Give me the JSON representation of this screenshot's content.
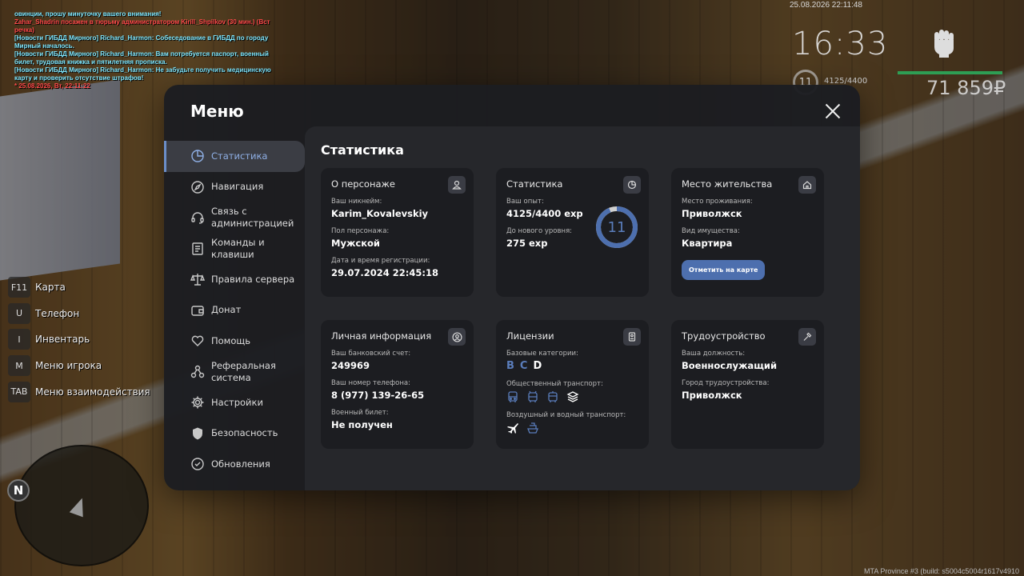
{
  "chat": [
    {
      "text": "овинции, прошу минуточку вашего внимания!",
      "color": "cyan"
    },
    {
      "text": "Zahar_Shadrin посажен в тюрьму администратором Kirill_Shpilkov (30 мин.) (Вст",
      "color": "red"
    },
    {
      "text": "речка)",
      "color": "red"
    },
    {
      "text": "[Новости ГИБДД Мирного] Richard_Harmon: Собеседование в ГИБДД по городу",
      "color": "cyan"
    },
    {
      "text": " Мирный началось.",
      "color": "cyan"
    },
    {
      "text": "[Новости ГИБДД Мирного] Richard_Harmon: Вам потребуется паспорт, военный",
      "color": "cyan"
    },
    {
      "text": " билет, трудовая книжка и пятилетняя прописка.",
      "color": "cyan"
    },
    {
      "text": "[Новости ГИБДД Мирного] Richard_Harmon: Не забудьте получить медицинскую",
      "color": "cyan"
    },
    {
      "text": " карту и проверить отсутствие штрафов!",
      "color": "cyan"
    },
    {
      "text": " * 25.08.2026, Вт, 22:11:22",
      "color": "red"
    }
  ],
  "hud": {
    "datetime": "25.08.2026 22:11:48",
    "time": "16:33",
    "level": "11",
    "exp": "4125/4400",
    "money": "71 859₽",
    "fist_icon": "fist-icon"
  },
  "keybinds": [
    {
      "key": "F11",
      "label": "Карта"
    },
    {
      "key": "U",
      "label": "Телефон"
    },
    {
      "key": "I",
      "label": "Инвентарь"
    },
    {
      "key": "M",
      "label": "Меню игрока"
    },
    {
      "key": "TAB",
      "label": "Меню взаимодействия"
    }
  ],
  "minimap": {
    "north": "N"
  },
  "build_info": "MTA Province #3 (build: s5004c5004r1617v4910",
  "menu": {
    "title": "Меню",
    "accent": "#6b8ec8",
    "nav": [
      {
        "label": "Статистика",
        "icon": "pie-chart-icon",
        "active": true
      },
      {
        "label": "Навигация",
        "icon": "compass-icon"
      },
      {
        "label": "Связь с администрацией",
        "icon": "headset-icon"
      },
      {
        "label": "Команды и клавиши",
        "icon": "document-icon"
      },
      {
        "label": "Правила сервера",
        "icon": "scales-icon"
      },
      {
        "label": "Донат",
        "icon": "wallet-icon"
      },
      {
        "label": "Помощь",
        "icon": "heart-hand-icon"
      },
      {
        "label": "Реферальная система",
        "icon": "network-icon"
      },
      {
        "label": "Настройки",
        "icon": "gear-icon"
      },
      {
        "label": "Безопасность",
        "icon": "shield-icon"
      },
      {
        "label": "Обновления",
        "icon": "refresh-icon"
      }
    ]
  },
  "content": {
    "title": "Статистика",
    "character": {
      "title": "О персонаже",
      "nick_label": "Ваш никнейм:",
      "nick": "Karim_Kovalevskiy",
      "sex_label": "Пол персонажа:",
      "sex": "Мужской",
      "reg_label": "Дата и время регистрации:",
      "reg": "29.07.2024 22:45:18"
    },
    "stats": {
      "title": "Статистика",
      "exp_label": "Ваш опыт:",
      "exp": "4125/4400 exp",
      "next_label": "До нового уровня:",
      "next": "275 exp",
      "level": "11",
      "level_progress": 0.9375
    },
    "residence": {
      "title": "Место жительства",
      "place_label": "Место проживания:",
      "place": "Приволжск",
      "property_label": "Вид имущества:",
      "property": "Квартира",
      "button": "Отметить на карте"
    },
    "personal": {
      "title": "Личная информация",
      "bank_label": "Ваш банковский счет:",
      "bank": "249969",
      "phone_label": "Ваш номер телефона:",
      "phone": "8 (977) 139-26-65",
      "military_label": "Военный билет:",
      "military": "Не получен"
    },
    "licenses": {
      "title": "Лицензии",
      "base_label": "Базовые категории:",
      "categories": [
        {
          "letter": "B",
          "owned": true
        },
        {
          "letter": "C",
          "owned": true
        },
        {
          "letter": "D",
          "owned": false
        }
      ],
      "public_label": "Общественный транспорт:",
      "public_icons": [
        "bus-icon",
        "trolleybus-icon",
        "tram-icon",
        "metro-icon"
      ],
      "air_label": "Воздушный и водный транспорт:",
      "air_icons": [
        "plane-icon",
        "ship-icon"
      ]
    },
    "job": {
      "title": "Трудоустройство",
      "position_label": "Ваша должность:",
      "position": "Военнослужащий",
      "city_label": "Город трудоустройства:",
      "city": "Приволжск"
    }
  }
}
